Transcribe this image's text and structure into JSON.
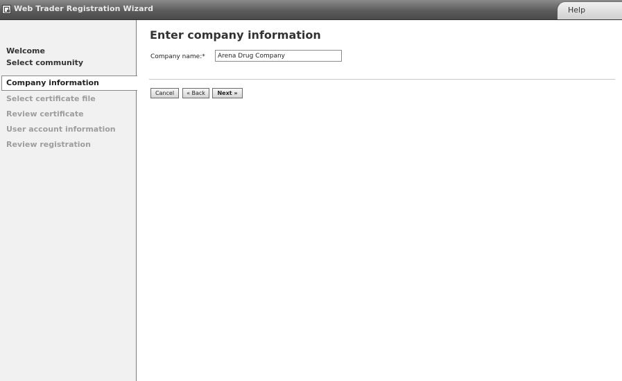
{
  "window": {
    "title": "Web Trader Registration Wizard",
    "help_label": "Help"
  },
  "sidebar": {
    "completed_steps": [
      "Welcome",
      "Select community"
    ],
    "current_step": "Company information",
    "upcoming_steps": [
      "Select certificate file",
      "Review certificate",
      "User account information",
      "Review registration"
    ]
  },
  "main": {
    "heading": "Enter company information",
    "company_name_label": "Company name:",
    "required_marker": "*",
    "company_name_value": "Arena Drug Company"
  },
  "buttons": {
    "cancel": "Cancel",
    "back": "« Back",
    "next": "Next »"
  }
}
